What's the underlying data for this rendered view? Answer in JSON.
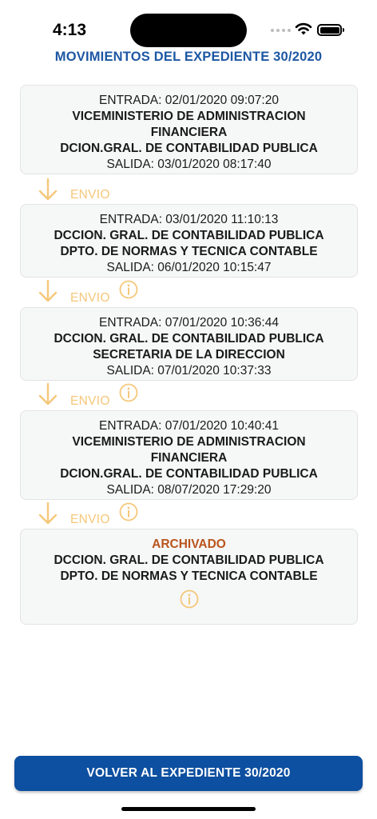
{
  "status_bar": {
    "time": "4:13"
  },
  "header": {
    "title": "MOVIMIENTOS DEL EXPEDIENTE 30/2020"
  },
  "movements": [
    {
      "entrada": "ENTRADA: 02/01/2020 09:07:20",
      "office_lines": [
        "VICEMINISTERIO DE ADMINISTRACION",
        "FINANCIERA",
        "DCION.GRAL. DE CONTABILIDAD PUBLICA"
      ],
      "salida": "SALIDA: 03/01/2020 08:17:40"
    },
    {
      "entrada": "ENTRADA: 03/01/2020 11:10:13",
      "office_lines": [
        "DCCION. GRAL. DE CONTABILIDAD PUBLICA",
        "DPTO. DE NORMAS Y TECNICA CONTABLE"
      ],
      "salida": "SALIDA: 06/01/2020 10:15:47"
    },
    {
      "entrada": "ENTRADA: 07/01/2020 10:36:44",
      "office_lines": [
        "DCCION. GRAL. DE CONTABILIDAD PUBLICA",
        "SECRETARIA DE LA DIRECCION"
      ],
      "salida": "SALIDA: 07/01/2020 10:37:33"
    },
    {
      "entrada": "ENTRADA: 07/01/2020 10:40:41",
      "office_lines": [
        "VICEMINISTERIO DE ADMINISTRACION",
        "FINANCIERA",
        "DCION.GRAL. DE CONTABILIDAD PUBLICA"
      ],
      "salida": "SALIDA: 08/07/2020 17:29:20"
    },
    {
      "status": "ARCHIVADO",
      "office_lines": [
        "DCCION. GRAL. DE CONTABILIDAD PUBLICA",
        "DPTO. DE NORMAS Y TECNICA CONTABLE"
      ]
    }
  ],
  "connectors": [
    {
      "label": "ENVIO"
    },
    {
      "label": "ENVIO"
    },
    {
      "label": "ENVIO"
    },
    {
      "label": "ENVIO"
    }
  ],
  "footer": {
    "back_button_label": "VOLVER AL EXPEDIENTE 30/2020"
  },
  "colors": {
    "title": "#1d57a3",
    "connector": "#f5c77a",
    "archived": "#b9541c",
    "button": "#0d4fa0"
  },
  "icons": {
    "arrow": "arrow-down-icon",
    "info": "info-icon"
  }
}
